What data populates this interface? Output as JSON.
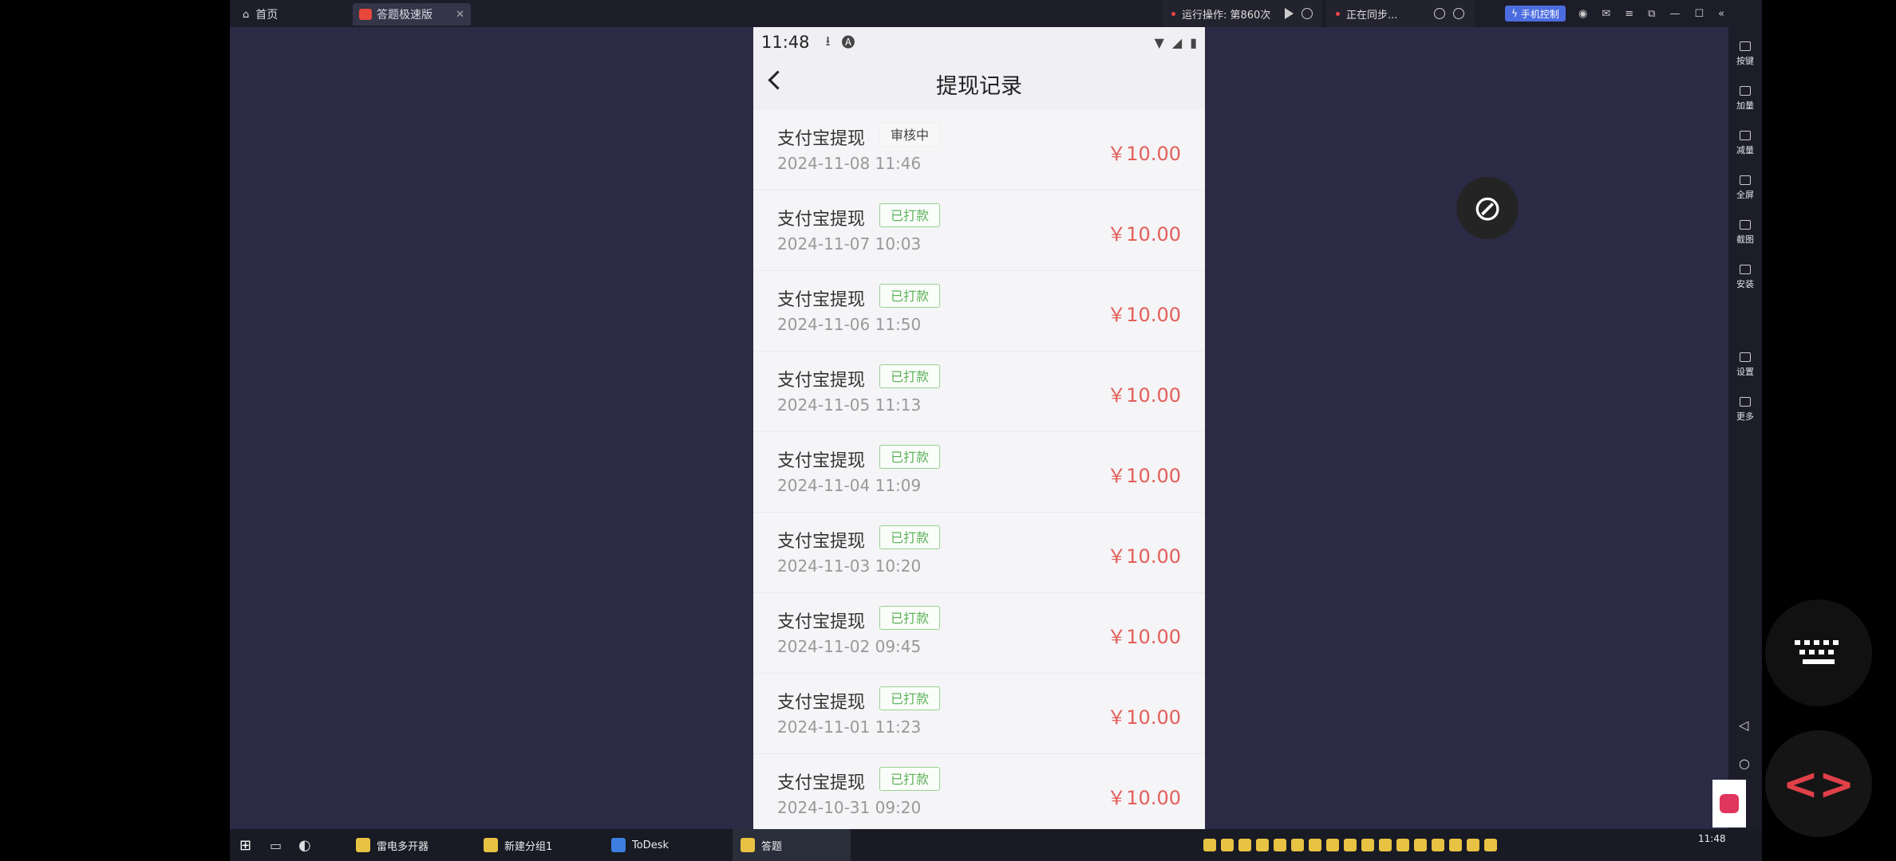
{
  "topbar": {
    "home_tab": "首页",
    "app_tab": "答题极速版",
    "run_status": "运行操作: 第860次",
    "sync_status": "正在同步...",
    "phone_control": "手机控制"
  },
  "sidebar": {
    "items": [
      {
        "label": "按键",
        "icon": "keyboard-icon"
      },
      {
        "label": "加量",
        "icon": "volume-up-icon"
      },
      {
        "label": "减量",
        "icon": "volume-down-icon"
      },
      {
        "label": "全屏",
        "icon": "fullscreen-icon"
      },
      {
        "label": "截图",
        "icon": "scissors-icon"
      },
      {
        "label": "安装",
        "icon": "install-icon"
      },
      {
        "label": "设置",
        "icon": "settings-icon"
      },
      {
        "label": "更多",
        "icon": "more-icon"
      }
    ]
  },
  "taskbar": {
    "items": [
      "雷电多开器",
      "新建分组1",
      "ToDesk",
      "答题"
    ],
    "clock": "11:48"
  },
  "phone": {
    "status_time": "11:48",
    "title": "提现记录",
    "records": [
      {
        "title": "支付宝提现",
        "status": "审核中",
        "status_type": "review",
        "date": "2024-11-08 11:46",
        "amount": "￥10.00"
      },
      {
        "title": "支付宝提现",
        "status": "已打款",
        "status_type": "done",
        "date": "2024-11-07 10:03",
        "amount": "￥10.00"
      },
      {
        "title": "支付宝提现",
        "status": "已打款",
        "status_type": "done",
        "date": "2024-11-06 11:50",
        "amount": "￥10.00"
      },
      {
        "title": "支付宝提现",
        "status": "已打款",
        "status_type": "done",
        "date": "2024-11-05 11:13",
        "amount": "￥10.00"
      },
      {
        "title": "支付宝提现",
        "status": "已打款",
        "status_type": "done",
        "date": "2024-11-04 11:09",
        "amount": "￥10.00"
      },
      {
        "title": "支付宝提现",
        "status": "已打款",
        "status_type": "done",
        "date": "2024-11-03 10:20",
        "amount": "￥10.00"
      },
      {
        "title": "支付宝提现",
        "status": "已打款",
        "status_type": "done",
        "date": "2024-11-02 09:45",
        "amount": "￥10.00"
      },
      {
        "title": "支付宝提现",
        "status": "已打款",
        "status_type": "done",
        "date": "2024-11-01 11:23",
        "amount": "￥10.00"
      },
      {
        "title": "支付宝提现",
        "status": "已打款",
        "status_type": "done",
        "date": "2024-10-31 09:20",
        "amount": "￥10.00"
      }
    ]
  },
  "colors": {
    "amount": "#e2605a",
    "badge_done": "#5cb35a",
    "emulator_bg": "#2c2b45"
  }
}
